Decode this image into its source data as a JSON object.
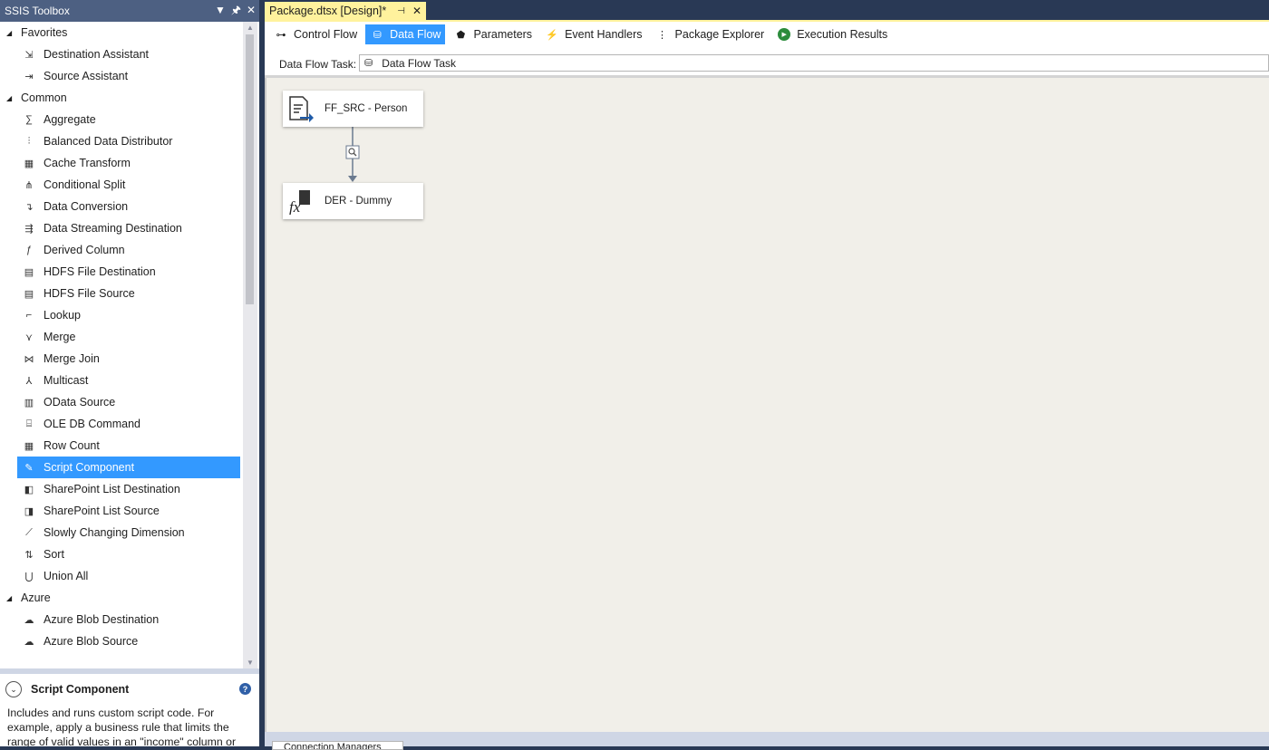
{
  "toolbox": {
    "title": "SSIS Toolbox",
    "buttons": {
      "dropdown": "▼",
      "pin": "ᵃ",
      "close": "✕"
    },
    "categories": [
      {
        "label": "Favorites",
        "items": [
          {
            "label": "Destination Assistant",
            "icon": "destination-assistant-icon"
          },
          {
            "label": "Source Assistant",
            "icon": "source-assistant-icon"
          }
        ]
      },
      {
        "label": "Common",
        "items": [
          {
            "label": "Aggregate",
            "icon": "aggregate-icon"
          },
          {
            "label": "Balanced Data Distributor",
            "icon": "balanced-distributor-icon"
          },
          {
            "label": "Cache Transform",
            "icon": "cache-transform-icon"
          },
          {
            "label": "Conditional Split",
            "icon": "conditional-split-icon"
          },
          {
            "label": "Data Conversion",
            "icon": "data-conversion-icon"
          },
          {
            "label": "Data Streaming Destination",
            "icon": "data-streaming-icon"
          },
          {
            "label": "Derived Column",
            "icon": "derived-column-icon"
          },
          {
            "label": "HDFS File Destination",
            "icon": "hdfs-destination-icon"
          },
          {
            "label": "HDFS File Source",
            "icon": "hdfs-source-icon"
          },
          {
            "label": "Lookup",
            "icon": "lookup-icon"
          },
          {
            "label": "Merge",
            "icon": "merge-icon"
          },
          {
            "label": "Merge Join",
            "icon": "merge-join-icon"
          },
          {
            "label": "Multicast",
            "icon": "multicast-icon"
          },
          {
            "label": "OData Source",
            "icon": "odata-source-icon"
          },
          {
            "label": "OLE DB Command",
            "icon": "oledb-command-icon"
          },
          {
            "label": "Row Count",
            "icon": "row-count-icon"
          },
          {
            "label": "Script Component",
            "icon": "script-component-icon",
            "selected": true
          },
          {
            "label": "SharePoint List Destination",
            "icon": "sharepoint-destination-icon"
          },
          {
            "label": "SharePoint List Source",
            "icon": "sharepoint-source-icon"
          },
          {
            "label": "Slowly Changing Dimension",
            "icon": "scd-icon"
          },
          {
            "label": "Sort",
            "icon": "sort-icon"
          },
          {
            "label": "Union All",
            "icon": "union-all-icon"
          }
        ]
      },
      {
        "label": "Azure",
        "items": [
          {
            "label": "Azure Blob Destination",
            "icon": "azure-blob-destination-icon"
          },
          {
            "label": "Azure Blob Source",
            "icon": "azure-blob-source-icon"
          }
        ]
      }
    ],
    "description": {
      "title": "Script Component",
      "text": "Includes and runs custom script code. For example, apply a business rule that limits the range of valid values in an \"income\" column or add values in two"
    }
  },
  "designer": {
    "tab": {
      "title": "Package.dtsx [Design]*",
      "pin": "⊣",
      "close": "✕"
    },
    "subtabs": [
      {
        "label": "Control Flow",
        "icon": "control-flow-icon",
        "active": false
      },
      {
        "label": "Data Flow",
        "icon": "data-flow-icon",
        "active": true
      },
      {
        "label": "Parameters",
        "icon": "parameters-icon",
        "active": false
      },
      {
        "label": "Event Handlers",
        "icon": "event-handlers-icon",
        "active": false
      },
      {
        "label": "Package Explorer",
        "icon": "package-explorer-icon",
        "active": false
      },
      {
        "label": "Execution Results",
        "icon": "execution-results-icon",
        "active": false
      }
    ],
    "task_label": "Data Flow Task:",
    "task_value": "Data Flow Task",
    "components": [
      {
        "label": "FF_SRC - Person",
        "icon": "flat-file-source-icon"
      },
      {
        "label": "DER - Dummy",
        "icon": "derived-column-icon"
      }
    ],
    "connection_tab": "Connection Managers"
  },
  "colors": {
    "accent": "#3399ff",
    "tab": "#fff29d",
    "titlebar": "#4d6082",
    "canvas": "#f1efe9"
  }
}
